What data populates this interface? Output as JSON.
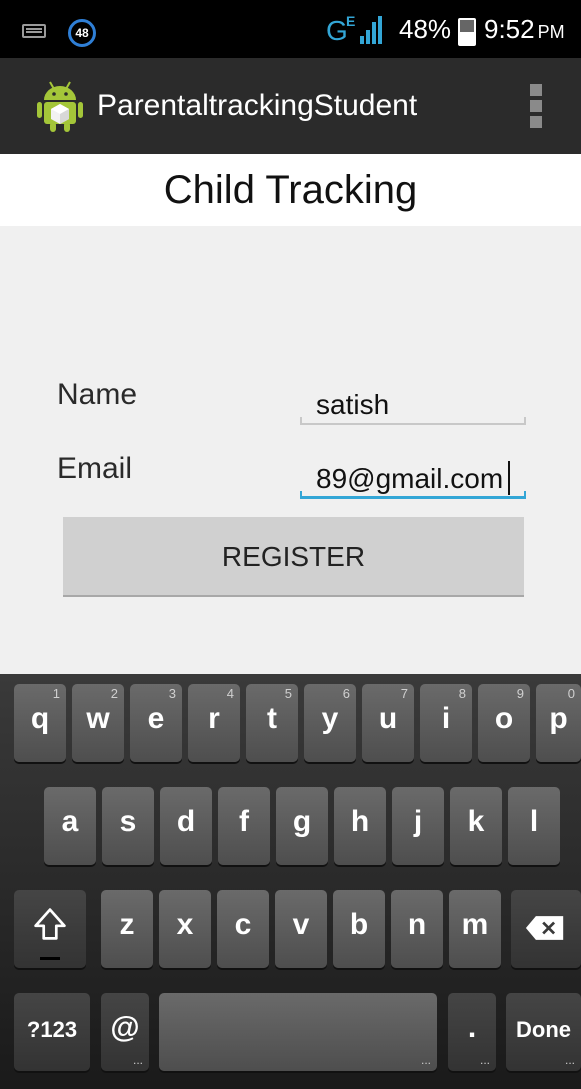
{
  "status_bar": {
    "notification_badge": "48",
    "network": "G",
    "network_sub": "E",
    "battery_percent": "48%",
    "battery_level": 0.48,
    "time": "9:52",
    "ampm": "PM"
  },
  "action_bar": {
    "app_title": "ParentaltrackingStudent",
    "icon": "android-icon",
    "overflow_icon": "overflow-menu-icon"
  },
  "page": {
    "title": "Child Tracking"
  },
  "form": {
    "name_label": "Name",
    "name_value": "satish",
    "email_label": "Email",
    "email_value": "89@gmail.com",
    "register_label": "REGISTER",
    "accent_color": "#33a6d6"
  },
  "keyboard": {
    "row1": [
      {
        "label": "q",
        "hint": "1"
      },
      {
        "label": "w",
        "hint": "2"
      },
      {
        "label": "e",
        "hint": "3"
      },
      {
        "label": "r",
        "hint": "4"
      },
      {
        "label": "t",
        "hint": "5"
      },
      {
        "label": "y",
        "hint": "6"
      },
      {
        "label": "u",
        "hint": "7"
      },
      {
        "label": "i",
        "hint": "8"
      },
      {
        "label": "o",
        "hint": "9"
      },
      {
        "label": "p",
        "hint": "0"
      }
    ],
    "row2": [
      "a",
      "s",
      "d",
      "f",
      "g",
      "h",
      "j",
      "k",
      "l"
    ],
    "row3": [
      "z",
      "x",
      "c",
      "v",
      "b",
      "n",
      "m"
    ],
    "symbols_label": "?123",
    "at_label": "@",
    "period_label": ".",
    "done_label": "Done",
    "shift_icon": "shift-icon",
    "backspace_icon": "backspace-icon"
  }
}
